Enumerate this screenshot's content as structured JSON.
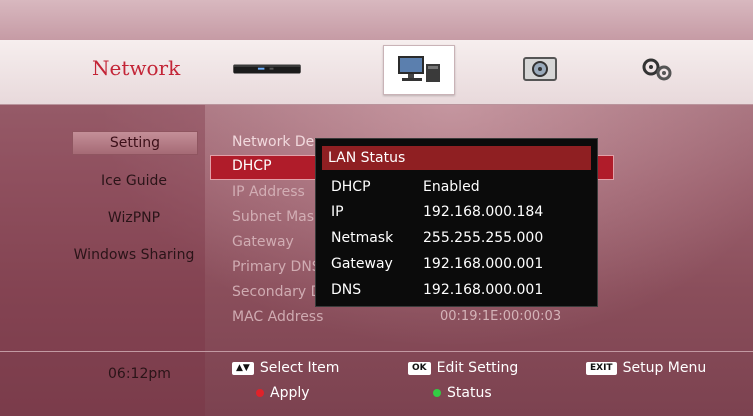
{
  "header": {
    "title": "Network",
    "icons": [
      "settop-box-icon",
      "computer-icon",
      "media-card-icon",
      "gears-icon"
    ]
  },
  "sidebar": {
    "items": [
      {
        "label": "Setting"
      },
      {
        "label": "Ice Guide"
      },
      {
        "label": "WizPNP"
      },
      {
        "label": "Windows Sharing"
      }
    ]
  },
  "settings": {
    "network_device": "Network Dev",
    "dhcp": "DHCP",
    "ip_address": "IP Address",
    "subnet_mask": "Subnet Mask",
    "gateway": "Gateway",
    "primary_dns": "Primary DNS",
    "secondary_dns": "Secondary D",
    "mac_address": "MAC Address",
    "mac_value": "00:19:1E:00:00:03"
  },
  "lan_status": {
    "title": "LAN Status",
    "rows": [
      {
        "key": "DHCP",
        "value": "Enabled"
      },
      {
        "key": "IP",
        "value": "192.168.000.184"
      },
      {
        "key": "Netmask",
        "value": "255.255.255.000"
      },
      {
        "key": "Gateway",
        "value": "192.168.000.001"
      },
      {
        "key": "DNS",
        "value": "192.168.000.001"
      }
    ]
  },
  "footer": {
    "time": "06:12pm",
    "select_key": "▲▼",
    "select_item": "Select Item",
    "ok_key": "OK",
    "edit_setting": "Edit Setting",
    "exit_key": "EXIT",
    "setup_menu": "Setup Menu",
    "apply": "Apply",
    "status": "Status",
    "colors": {
      "apply": "#e0222a",
      "status": "#33cc44"
    }
  }
}
